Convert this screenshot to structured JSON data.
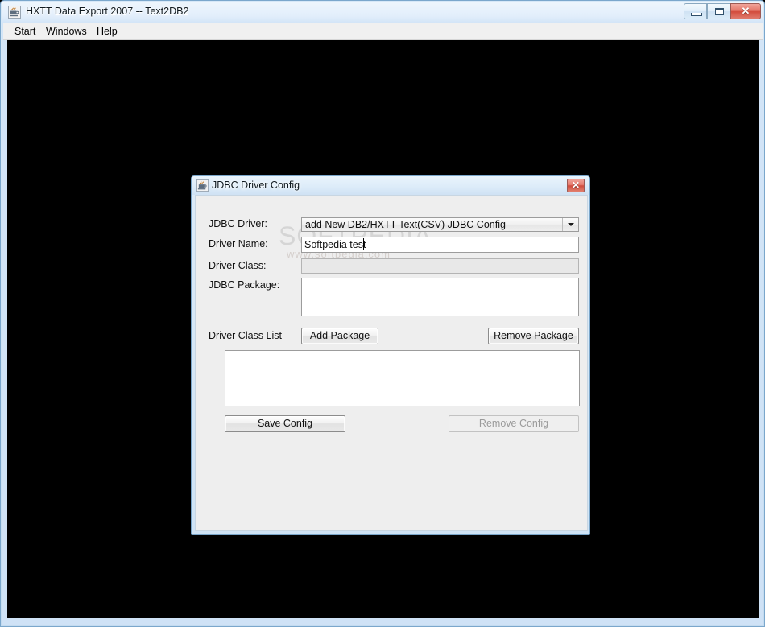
{
  "window": {
    "title": "HXTT Data Export 2007 -- Text2DB2",
    "icon": "java-coffee-cup-icon",
    "controls": {
      "minimize": "Minimize",
      "maximize": "Maximize",
      "close": "✕"
    }
  },
  "menu": {
    "items": [
      {
        "label": "Start"
      },
      {
        "label": "Windows"
      },
      {
        "label": "Help"
      }
    ]
  },
  "dialog": {
    "title": "JDBC Driver Config",
    "icon": "java-coffee-cup-icon",
    "close_glyph": "✕",
    "fields": {
      "jdbc_driver": {
        "label": "JDBC Driver:",
        "value": "add New DB2/HXTT Text(CSV) JDBC Config",
        "options": [
          "add New DB2/HXTT Text(CSV) JDBC Config"
        ]
      },
      "driver_name": {
        "label": "Driver Name:",
        "value": "Softpedia test",
        "placeholder": ""
      },
      "driver_class": {
        "label": "Driver Class:",
        "value": "",
        "placeholder": "",
        "disabled": true
      },
      "jdbc_package": {
        "label": "JDBC Package:",
        "value": "",
        "placeholder": ""
      },
      "driver_class_list": {
        "label": "Driver Class List",
        "items": []
      }
    },
    "buttons": {
      "add_package": "Add Package",
      "remove_package": "Remove Package",
      "save_config": "Save Config",
      "remove_config": "Remove Config"
    }
  },
  "watermark": {
    "main": "SOFTPEDIA",
    "sub": "www.softpedia.com"
  },
  "colors": {
    "client_background": "#000000",
    "window_chrome": "#cfe2f6",
    "dialog_body": "#eeeeee",
    "close_button": "#d24b3c"
  }
}
